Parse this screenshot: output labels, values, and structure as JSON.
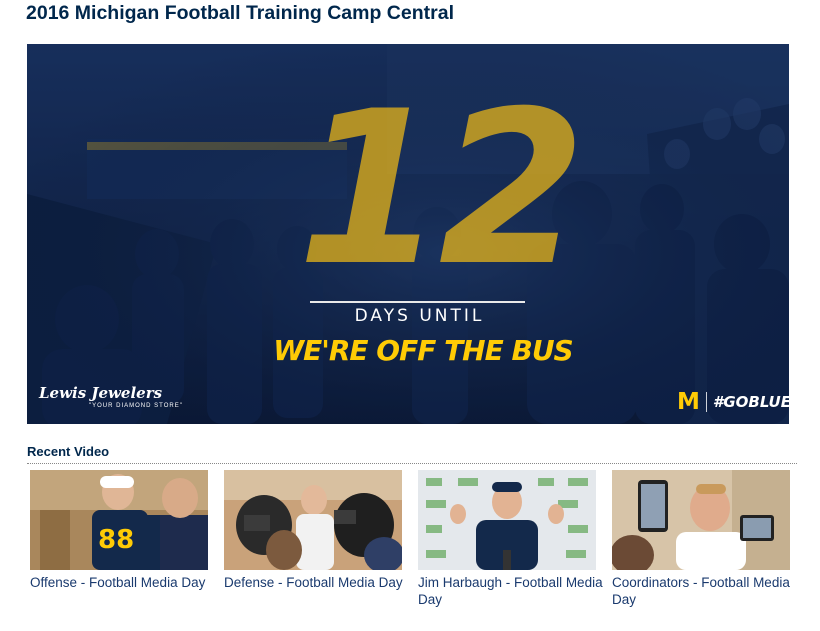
{
  "page": {
    "title": "2016 Michigan Football Training Camp Central"
  },
  "hero": {
    "countdown": "12",
    "subtitle": "DAYS UNTIL",
    "headline": "WE'RE OFF THE BUS",
    "sponsor_name": "Lewis Jewelers",
    "sponsor_tagline": "\"YOUR DIAMOND STORE\"",
    "logo_letter": "M",
    "hashtag": "#GOBLUE",
    "colors": {
      "maize": "#ffcb05",
      "blue": "#00274c"
    }
  },
  "recent_video": {
    "heading": "Recent Video",
    "items": [
      {
        "title": "Offense - Football Media Day",
        "icon": "video-thumbnail"
      },
      {
        "title": "Defense - Football Media Day",
        "icon": "video-thumbnail"
      },
      {
        "title": "Jim Harbaugh - Football Media Day",
        "icon": "video-thumbnail"
      },
      {
        "title": "Coordinators - Football Media Day",
        "icon": "video-thumbnail"
      }
    ]
  }
}
